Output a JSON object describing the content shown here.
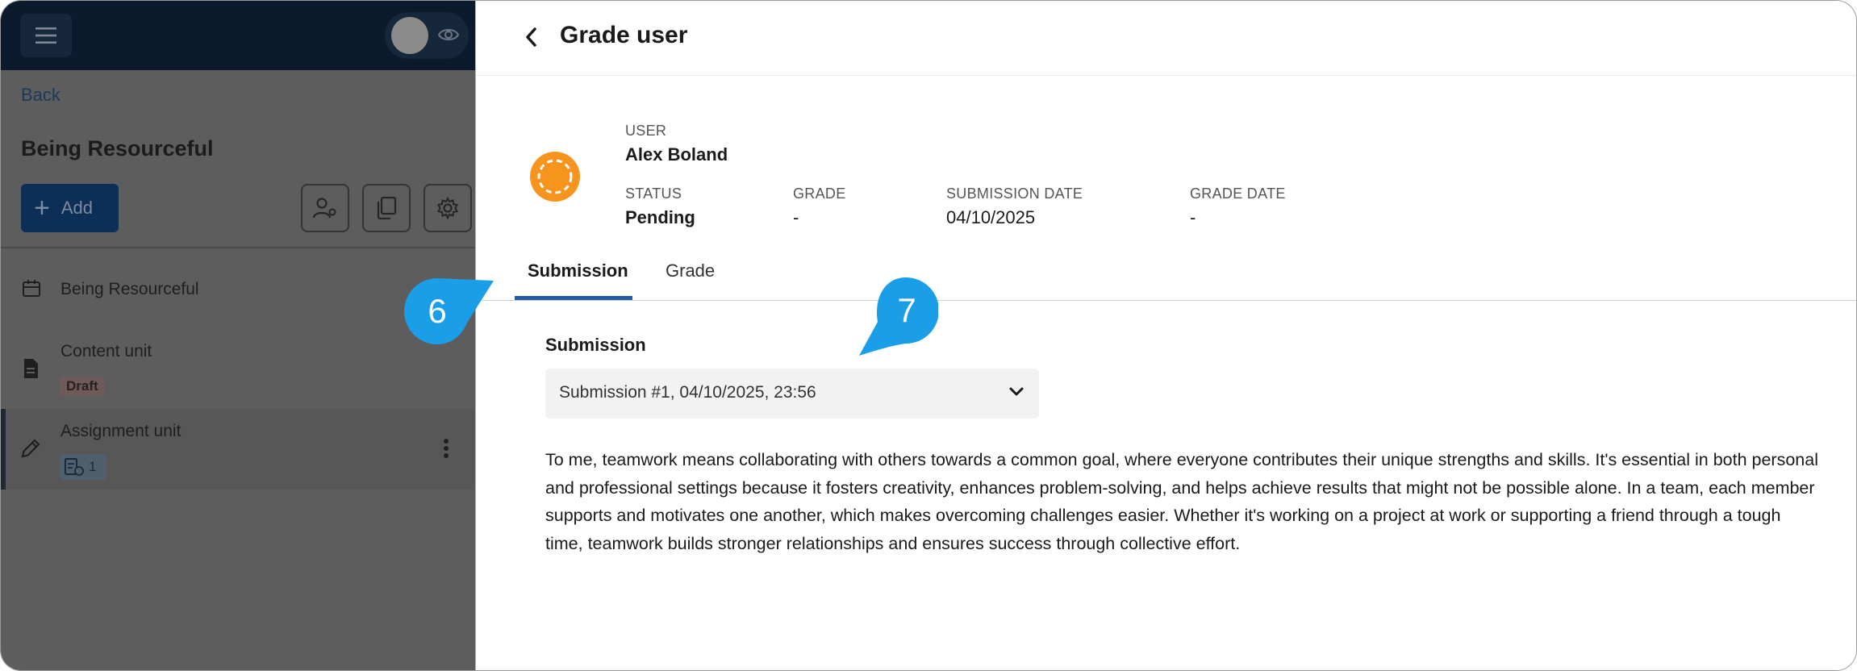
{
  "sidebar": {
    "back_label": "Back",
    "course_title": "Being Resourceful",
    "add_label": "Add",
    "items": [
      {
        "label": "Being Resourceful",
        "icon": "box-icon"
      },
      {
        "label": "Content unit",
        "icon": "document-icon",
        "badge": "Draft"
      },
      {
        "label": "Assignment unit",
        "icon": "pencil-icon",
        "count": "1"
      }
    ]
  },
  "header": {
    "title": "Grade user"
  },
  "user_info": {
    "user_label": "USER",
    "user_name": "Alex Boland",
    "status_label": "STATUS",
    "status_value": "Pending",
    "grade_label": "GRADE",
    "grade_value": "-",
    "submission_date_label": "SUBMISSION DATE",
    "submission_date_value": "04/10/2025",
    "grade_date_label": "GRADE DATE",
    "grade_date_value": "-"
  },
  "tabs": [
    {
      "label": "Submission",
      "active": true
    },
    {
      "label": "Grade",
      "active": false
    }
  ],
  "submission": {
    "section_label": "Submission",
    "selected": "Submission #1, 04/10/2025, 23:56",
    "text": "To me, teamwork means collaborating with others towards a common goal, where everyone contributes their unique strengths and skills. It's essential in both personal and professional settings because it fosters creativity, enhances problem-solving, and helps achieve results that might not be possible alone. In a team, each member supports and motivates one another, which makes overcoming challenges easier. Whether it's working on a project at work or supporting a friend through a tough time, teamwork builds stronger relationships and ensures success through collective effort."
  },
  "callouts": [
    "6",
    "7"
  ],
  "colors": {
    "accent": "#1f5aa6",
    "callout": "#1b9ee8",
    "avatar": "#f7941d"
  }
}
